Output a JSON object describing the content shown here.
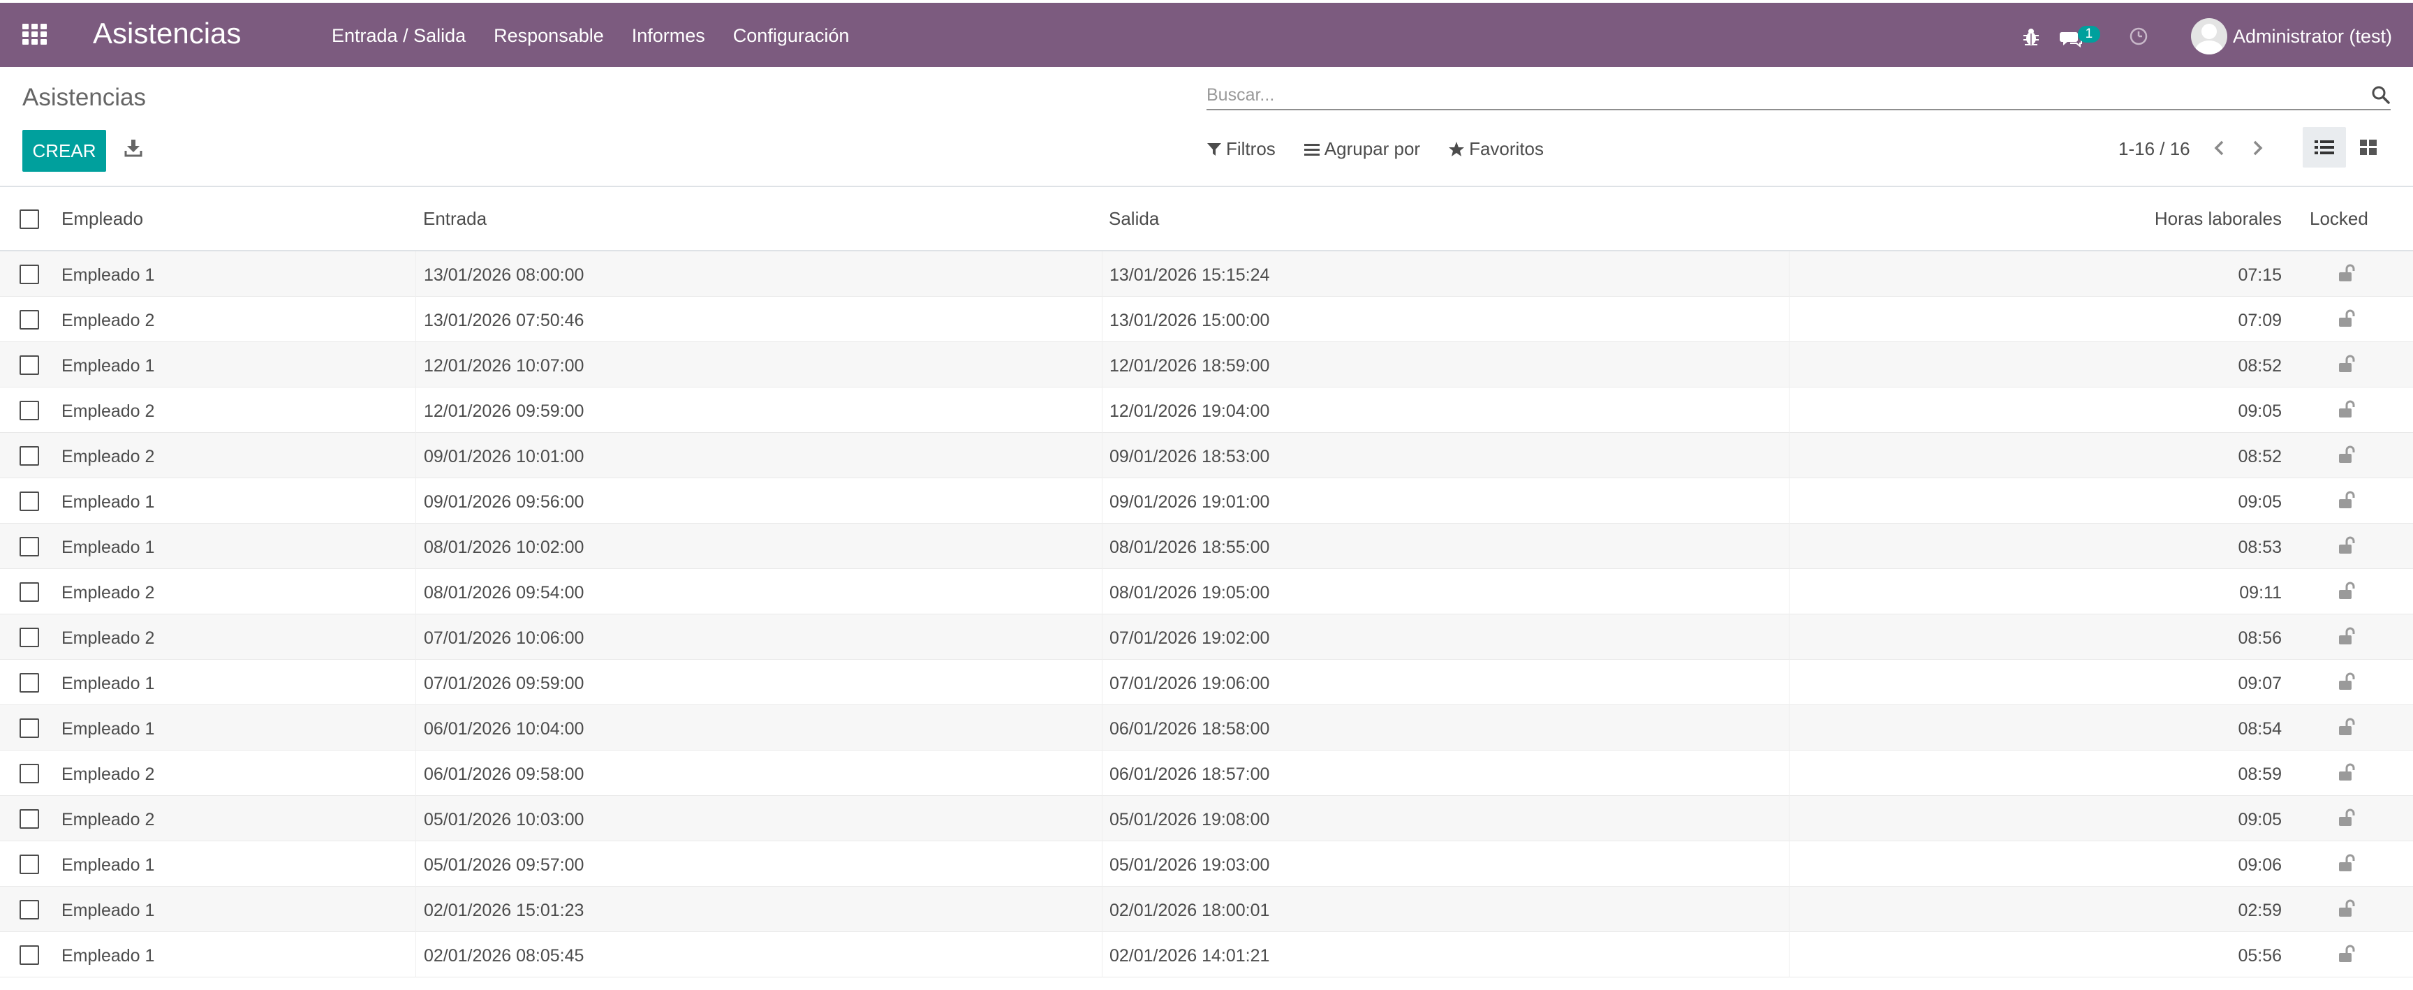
{
  "navbar": {
    "app_title": "Asistencias",
    "menu": [
      {
        "label": "Entrada / Salida"
      },
      {
        "label": "Responsable"
      },
      {
        "label": "Informes"
      },
      {
        "label": "Configuración"
      }
    ],
    "chat_badge": "1",
    "user_name": "Administrator (test)",
    "color": "#7c5b7f"
  },
  "control_panel": {
    "breadcrumb": "Asistencias",
    "search_placeholder": "Buscar...",
    "create_label": "CREAR",
    "filters_label": "Filtros",
    "group_by_label": "Agrupar por",
    "favorites_label": "Favoritos",
    "pager": "1-16 / 16",
    "active_view": "list",
    "accent_color": "#00a09d"
  },
  "table": {
    "headers": {
      "employee": "Empleado",
      "check_in": "Entrada",
      "check_out": "Salida",
      "worked_hours": "Horas laborales",
      "locked": "Locked"
    },
    "rows": [
      {
        "employee": "Empleado 1",
        "check_in": "13/01/2026 08:00:00",
        "check_out": "13/01/2026 15:15:24",
        "worked_hours": "07:15",
        "locked_icon": "unlock-icon"
      },
      {
        "employee": "Empleado 2",
        "check_in": "13/01/2026 07:50:46",
        "check_out": "13/01/2026 15:00:00",
        "worked_hours": "07:09",
        "locked_icon": "unlock-icon"
      },
      {
        "employee": "Empleado 1",
        "check_in": "12/01/2026 10:07:00",
        "check_out": "12/01/2026 18:59:00",
        "worked_hours": "08:52",
        "locked_icon": "unlock-icon"
      },
      {
        "employee": "Empleado 2",
        "check_in": "12/01/2026 09:59:00",
        "check_out": "12/01/2026 19:04:00",
        "worked_hours": "09:05",
        "locked_icon": "unlock-icon"
      },
      {
        "employee": "Empleado 2",
        "check_in": "09/01/2026 10:01:00",
        "check_out": "09/01/2026 18:53:00",
        "worked_hours": "08:52",
        "locked_icon": "unlock-icon"
      },
      {
        "employee": "Empleado 1",
        "check_in": "09/01/2026 09:56:00",
        "check_out": "09/01/2026 19:01:00",
        "worked_hours": "09:05",
        "locked_icon": "unlock-icon"
      },
      {
        "employee": "Empleado 1",
        "check_in": "08/01/2026 10:02:00",
        "check_out": "08/01/2026 18:55:00",
        "worked_hours": "08:53",
        "locked_icon": "unlock-icon"
      },
      {
        "employee": "Empleado 2",
        "check_in": "08/01/2026 09:54:00",
        "check_out": "08/01/2026 19:05:00",
        "worked_hours": "09:11",
        "locked_icon": "unlock-icon"
      },
      {
        "employee": "Empleado 2",
        "check_in": "07/01/2026 10:06:00",
        "check_out": "07/01/2026 19:02:00",
        "worked_hours": "08:56",
        "locked_icon": "unlock-icon"
      },
      {
        "employee": "Empleado 1",
        "check_in": "07/01/2026 09:59:00",
        "check_out": "07/01/2026 19:06:00",
        "worked_hours": "09:07",
        "locked_icon": "unlock-icon"
      },
      {
        "employee": "Empleado 1",
        "check_in": "06/01/2026 10:04:00",
        "check_out": "06/01/2026 18:58:00",
        "worked_hours": "08:54",
        "locked_icon": "unlock-icon"
      },
      {
        "employee": "Empleado 2",
        "check_in": "06/01/2026 09:58:00",
        "check_out": "06/01/2026 18:57:00",
        "worked_hours": "08:59",
        "locked_icon": "unlock-icon"
      },
      {
        "employee": "Empleado 2",
        "check_in": "05/01/2026 10:03:00",
        "check_out": "05/01/2026 19:08:00",
        "worked_hours": "09:05",
        "locked_icon": "unlock-icon"
      },
      {
        "employee": "Empleado 1",
        "check_in": "05/01/2026 09:57:00",
        "check_out": "05/01/2026 19:03:00",
        "worked_hours": "09:06",
        "locked_icon": "unlock-icon"
      },
      {
        "employee": "Empleado 1",
        "check_in": "02/01/2026 15:01:23",
        "check_out": "02/01/2026 18:00:01",
        "worked_hours": "02:59",
        "locked_icon": "unlock-icon"
      },
      {
        "employee": "Empleado 1",
        "check_in": "02/01/2026 08:05:45",
        "check_out": "02/01/2026 14:01:21",
        "worked_hours": "05:56",
        "locked_icon": "unlock-icon"
      }
    ]
  }
}
